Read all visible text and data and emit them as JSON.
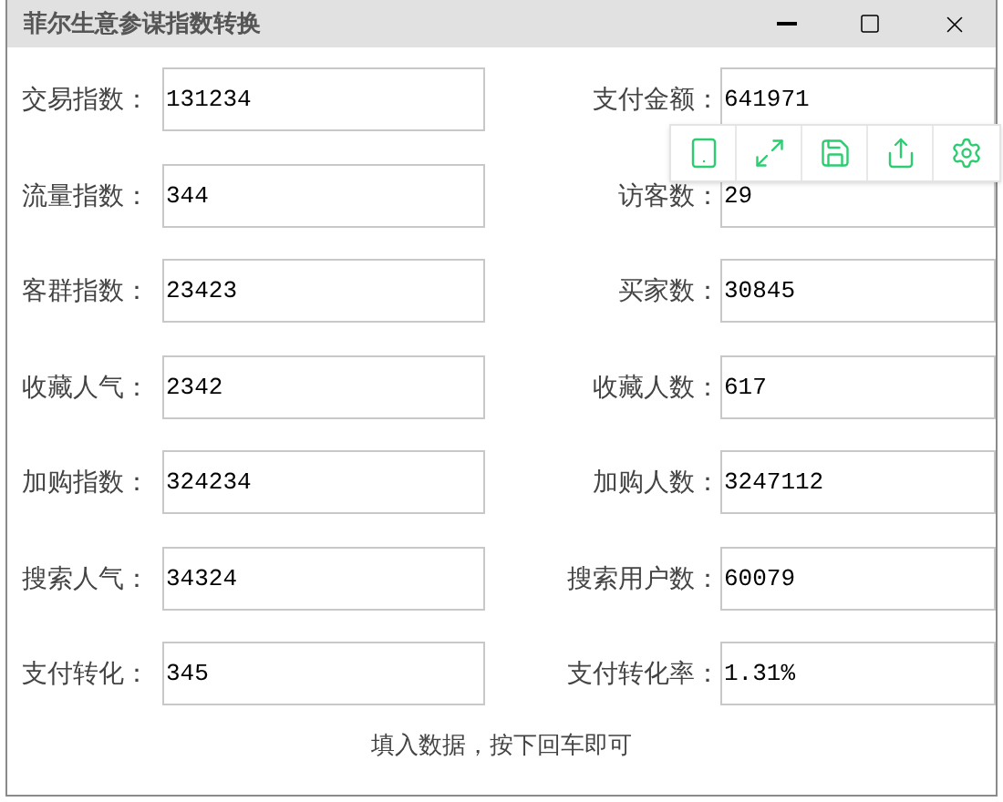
{
  "window": {
    "title": "菲尔生意参谋指数转换"
  },
  "rows": [
    {
      "left": {
        "label": "交易指数：",
        "value": "131234"
      },
      "right": {
        "label": "支付金额：",
        "value": "641971"
      }
    },
    {
      "left": {
        "label": "流量指数：",
        "value": "344"
      },
      "right": {
        "label": "访客数：",
        "value": "29"
      }
    },
    {
      "left": {
        "label": "客群指数：",
        "value": "23423"
      },
      "right": {
        "label": "买家数：",
        "value": "30845"
      }
    },
    {
      "left": {
        "label": "收藏人气：",
        "value": "2342"
      },
      "right": {
        "label": "收藏人数：",
        "value": "617"
      }
    },
    {
      "left": {
        "label": "加购指数：",
        "value": "324234"
      },
      "right": {
        "label": "加购人数：",
        "value": "3247112"
      }
    },
    {
      "left": {
        "label": "搜索人气：",
        "value": "34324"
      },
      "right": {
        "label": "搜索用户数：",
        "value": "60079"
      }
    },
    {
      "left": {
        "label": "支付转化：",
        "value": "345"
      },
      "right": {
        "label": "支付转化率：",
        "value": "1.31%"
      }
    }
  ],
  "hint": "填入数据，按下回车即可",
  "toolbar": [
    {
      "kind": "tablet"
    },
    {
      "kind": "expand"
    },
    {
      "kind": "save"
    },
    {
      "kind": "share"
    },
    {
      "kind": "settings"
    }
  ]
}
